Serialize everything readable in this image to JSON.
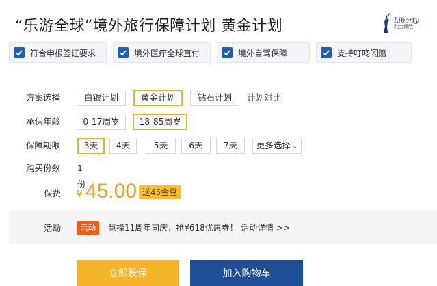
{
  "header": {
    "title": "“乐游全球”境外旅行保障计划  黄金计划",
    "logo_en": "Liberty",
    "logo_cn": "利宝保险"
  },
  "features": [
    {
      "label": "符合申根签证要求"
    },
    {
      "label": "境外医疗全球直付"
    },
    {
      "label": "境外自驾保障"
    },
    {
      "label": "支持叮咚闪赔"
    }
  ],
  "plan": {
    "label": "方案选择",
    "options": [
      "白银计划",
      "黄金计划",
      "钻石计划"
    ],
    "selected": "黄金计划",
    "compare_link": "计划对比"
  },
  "age": {
    "label": "承保年龄",
    "options": [
      "0-17周岁",
      "18-85周岁"
    ],
    "selected": "18-85周岁"
  },
  "period": {
    "label": "保障期限",
    "options": [
      "3天",
      "4天",
      "5天",
      "6天",
      "7天"
    ],
    "selected": "3天",
    "more": "更多选择"
  },
  "quantity": {
    "label": "购买份数",
    "value": "1份"
  },
  "premium": {
    "label": "保费",
    "currency": "¥",
    "amount": "45.00",
    "bonus": "送45金豆"
  },
  "activity": {
    "label": "活动",
    "tag": "活动",
    "text": "慧择11周年司庆，抢¥618优惠券！",
    "link": "活动详情 >>"
  },
  "actions": {
    "buy": "立即投保",
    "cart": "加入购物车"
  },
  "colors": {
    "accent": "#f0b22e",
    "price": "#f0a020",
    "primary_blue": "#1e4e96",
    "check_blue": "#1f5fb5",
    "activity_tag": "#f25c1a"
  }
}
